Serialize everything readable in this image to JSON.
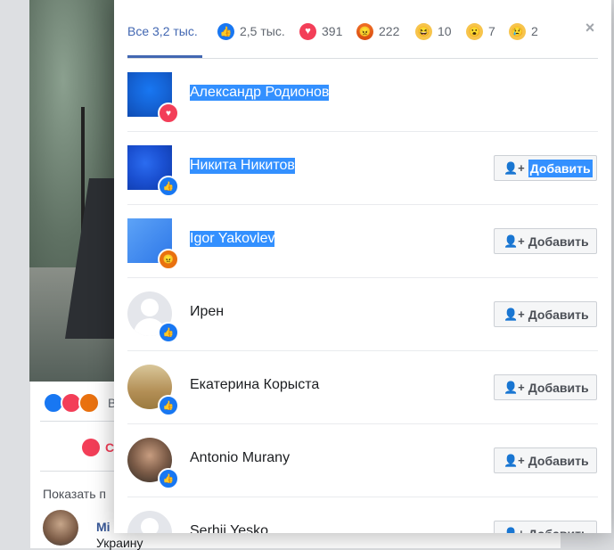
{
  "background": {
    "reaction_text": "В",
    "love_label": "С",
    "show_text": "Показать п",
    "commenter_name": "Mi",
    "commenter_text": "Украину"
  },
  "modal": {
    "tabs": [
      {
        "label": "Все 3,2 тыс.",
        "icon": "none"
      },
      {
        "label": "2,5 тыс.",
        "icon": "like-icon"
      },
      {
        "label": "391",
        "icon": "love-icon"
      },
      {
        "label": "222",
        "icon": "angry-icon"
      },
      {
        "label": "10",
        "icon": "haha-icon"
      },
      {
        "label": "7",
        "icon": "wow-icon"
      },
      {
        "label": "2",
        "icon": "sad-icon"
      }
    ],
    "close_glyph": "×",
    "people": [
      {
        "name": "Александр Родионов",
        "reaction": "love",
        "has_add": false
      },
      {
        "name": "Никита Никитов",
        "reaction": "like",
        "has_add": true
      },
      {
        "name": "Igor Yakovlev",
        "reaction": "angry",
        "has_add": true
      },
      {
        "name": "Ирен",
        "reaction": "like",
        "has_add": true
      },
      {
        "name": "Екатерина Корыста",
        "reaction": "like",
        "has_add": true
      },
      {
        "name": "Antonio Murany",
        "reaction": "like",
        "has_add": true
      },
      {
        "name": "Serhii Yesko",
        "reaction": "like",
        "has_add": true
      }
    ],
    "add_label": "Добавить"
  }
}
